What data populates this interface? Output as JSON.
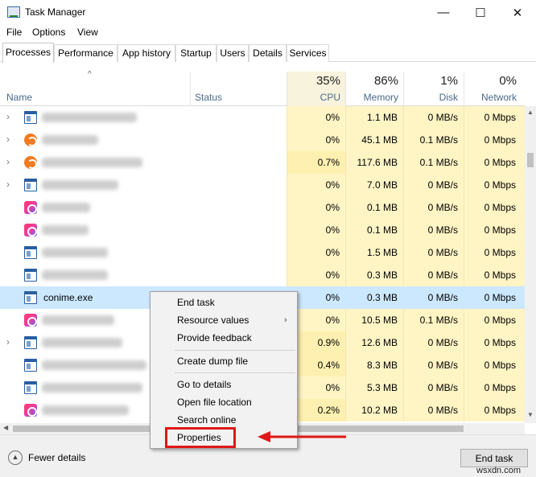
{
  "window": {
    "title": "Task Manager",
    "minimize_glyph": "—",
    "maximize_glyph": "☐",
    "close_glyph": "✕"
  },
  "menu": [
    "File",
    "Options",
    "View"
  ],
  "tabs": [
    "Processes",
    "Performance",
    "App history",
    "Startup",
    "Users",
    "Details",
    "Services"
  ],
  "columns": {
    "name": "Name",
    "status": "Status",
    "cpu_pct": "35%",
    "cpu": "CPU",
    "memory_pct": "86%",
    "memory": "Memory",
    "disk_pct": "1%",
    "disk": "Disk",
    "network_pct": "0%",
    "network": "Network"
  },
  "processes": [
    {
      "name": "",
      "icon": "window-icon",
      "expandable": true,
      "cpu": "0%",
      "memory": "1.1 MB",
      "disk": "0 MB/s",
      "network": "0 Mbps"
    },
    {
      "name": "",
      "icon": "avast-icon",
      "expandable": true,
      "cpu": "0%",
      "memory": "45.1 MB",
      "disk": "0.1 MB/s",
      "network": "0 Mbps"
    },
    {
      "name": "",
      "icon": "avast-icon",
      "expandable": true,
      "cpu": "0.7%",
      "memory": "117.6 MB",
      "disk": "0.1 MB/s",
      "network": "0 Mbps"
    },
    {
      "name": "",
      "icon": "window-icon",
      "expandable": true,
      "cpu": "0%",
      "memory": "7.0 MB",
      "disk": "0 MB/s",
      "network": "0 Mbps"
    },
    {
      "name": "",
      "icon": "creative-cloud-icon",
      "expandable": false,
      "cpu": "0%",
      "memory": "0.1 MB",
      "disk": "0 MB/s",
      "network": "0 Mbps"
    },
    {
      "name": "",
      "icon": "creative-cloud-icon",
      "expandable": false,
      "cpu": "0%",
      "memory": "0.1 MB",
      "disk": "0 MB/s",
      "network": "0 Mbps"
    },
    {
      "name": "",
      "icon": "window-icon",
      "expandable": false,
      "cpu": "0%",
      "memory": "1.5 MB",
      "disk": "0 MB/s",
      "network": "0 Mbps"
    },
    {
      "name": "",
      "icon": "window-icon",
      "expandable": false,
      "cpu": "0%",
      "memory": "0.3 MB",
      "disk": "0 MB/s",
      "network": "0 Mbps"
    },
    {
      "name": "conime.exe",
      "icon": "window-icon",
      "expandable": false,
      "selected": true,
      "cpu": "0%",
      "memory": "0.3 MB",
      "disk": "0 MB/s",
      "network": "0 Mbps"
    },
    {
      "name": "",
      "icon": "creative-cloud-icon",
      "expandable": false,
      "cpu": "0%",
      "memory": "10.5 MB",
      "disk": "0.1 MB/s",
      "network": "0 Mbps"
    },
    {
      "name": "",
      "icon": "window-icon",
      "expandable": true,
      "cpu": "0.9%",
      "memory": "12.6 MB",
      "disk": "0 MB/s",
      "network": "0 Mbps"
    },
    {
      "name": "",
      "icon": "window-icon",
      "expandable": false,
      "cpu": "0.4%",
      "memory": "8.3 MB",
      "disk": "0 MB/s",
      "network": "0 Mbps"
    },
    {
      "name": "",
      "icon": "window-icon",
      "expandable": false,
      "cpu": "0%",
      "memory": "5.3 MB",
      "disk": "0 MB/s",
      "network": "0 Mbps"
    },
    {
      "name": "",
      "icon": "creative-cloud-icon",
      "expandable": false,
      "cpu": "0.2%",
      "memory": "10.2 MB",
      "disk": "0 MB/s",
      "network": "0 Mbps"
    }
  ],
  "context_menu": {
    "end_task": "End task",
    "resource_values": "Resource values",
    "provide_feedback": "Provide feedback",
    "create_dump_file": "Create dump file",
    "go_to_details": "Go to details",
    "open_file_location": "Open file location",
    "search_online": "Search online",
    "properties": "Properties"
  },
  "footer": {
    "fewer_details": "Fewer details",
    "end_task": "End task",
    "watermark": "wsxdn.com"
  },
  "colors": {
    "cpu_heat_light": "#fff4c4",
    "cpu_heat_medium": "#fef0b0",
    "selection": "#cce8ff",
    "annotation_red": "#e01818"
  }
}
